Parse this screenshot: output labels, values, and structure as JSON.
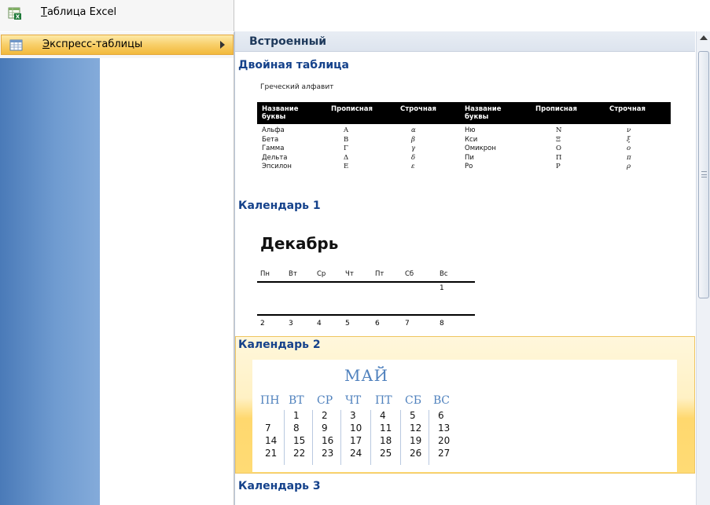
{
  "menu": {
    "excel_label_first": "Т",
    "excel_label_rest": "аблица Excel",
    "quick_label_first": "Э",
    "quick_label_rest": "кспресс-таблицы"
  },
  "gallery": {
    "header": "Встроенный",
    "sections": {
      "double": "Двойная таблица",
      "cal1": "Календарь 1",
      "cal2": "Календарь 2",
      "cal3": "Календарь 3"
    }
  },
  "double_table": {
    "caption": "Греческий алфавит",
    "headers": [
      "Название буквы",
      "Прописная",
      "Строчная",
      "Название буквы",
      "Прописная",
      "Строчная"
    ],
    "rows": [
      [
        "Альфа",
        "Α",
        "α",
        "Ню",
        "Ν",
        "ν"
      ],
      [
        "Бета",
        "Β",
        "β",
        "Кси",
        "Ξ",
        "ξ"
      ],
      [
        "Гамма",
        "Γ",
        "γ",
        "Омикрон",
        "Ο",
        "ο"
      ],
      [
        "Дельта",
        "Δ",
        "δ",
        "Пи",
        "Π",
        "π"
      ],
      [
        "Эпсилон",
        "Ε",
        "ε",
        "Ро",
        "Ρ",
        "ρ"
      ]
    ]
  },
  "calendar1": {
    "month": "Декабрь",
    "days": [
      "Пн",
      "Вт",
      "Ср",
      "Чт",
      "Пт",
      "Сб",
      "Вс"
    ],
    "week1": [
      "",
      "",
      "",
      "",
      "",
      "",
      "1"
    ],
    "week2": [
      "2",
      "3",
      "4",
      "5",
      "6",
      "7",
      "8"
    ]
  },
  "calendar2": {
    "month": "МАЙ",
    "days": [
      "ПН",
      "ВТ",
      "СР",
      "ЧТ",
      "ПТ",
      "СБ",
      "ВС"
    ],
    "weeks": [
      [
        "",
        "1",
        "2",
        "3",
        "4",
        "5",
        "6"
      ],
      [
        "7",
        "8",
        "9",
        "10",
        "11",
        "12",
        "13"
      ],
      [
        "14",
        "15",
        "16",
        "17",
        "18",
        "19",
        "20"
      ],
      [
        "21",
        "22",
        "23",
        "24",
        "25",
        "26",
        "27"
      ]
    ]
  }
}
